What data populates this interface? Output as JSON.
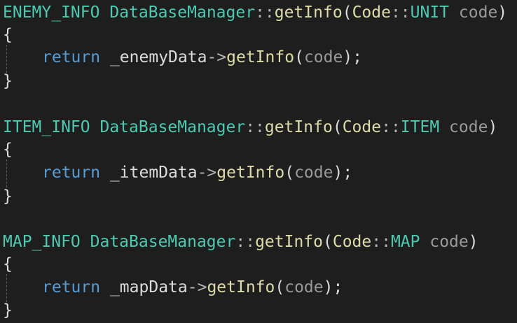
{
  "colors": {
    "background": "#1e1e1e",
    "type": "#4ec9b0",
    "class": "#4ec9b0",
    "function": "#dcdcaa",
    "namespace": "#dcdcaa",
    "enum_member": "#4ec9b0",
    "parameter": "#9a9a9a",
    "keyword": "#569cd6",
    "text": "#dcdcdc",
    "operator": "#b4b4b4"
  },
  "code": {
    "functions": [
      {
        "return_type": "ENEMY_INFO",
        "class_name": "DataBaseManager",
        "scope_op": "::",
        "method": "getInfo",
        "open_paren": "(",
        "param_ns": "Code",
        "param_scope": "::",
        "param_enum": "UNIT",
        "param_name": "code",
        "close_paren": ")",
        "open_brace": "{",
        "keyword": "return",
        "member": "_enemyData",
        "arrow": "->",
        "call": "getInfo",
        "call_open": "(",
        "arg": "code",
        "call_close": ");",
        "close_brace": "}"
      },
      {
        "return_type": "ITEM_INFO",
        "class_name": "DataBaseManager",
        "scope_op": "::",
        "method": "getInfo",
        "open_paren": "(",
        "param_ns": "Code",
        "param_scope": "::",
        "param_enum": "ITEM",
        "param_name": "code",
        "close_paren": ")",
        "open_brace": "{",
        "keyword": "return",
        "member": "_itemData",
        "arrow": "->",
        "call": "getInfo",
        "call_open": "(",
        "arg": "code",
        "call_close": ");",
        "close_brace": "}"
      },
      {
        "return_type": "MAP_INFO",
        "class_name": "DataBaseManager",
        "scope_op": "::",
        "method": "getInfo",
        "open_paren": "(",
        "param_ns": "Code",
        "param_scope": "::",
        "param_enum": "MAP",
        "param_name": "code",
        "close_paren": ")",
        "open_brace": "{",
        "keyword": "return",
        "member": "_mapData",
        "arrow": "->",
        "call": "getInfo",
        "call_open": "(",
        "arg": "code",
        "call_close": ");",
        "close_brace": "}"
      }
    ]
  }
}
